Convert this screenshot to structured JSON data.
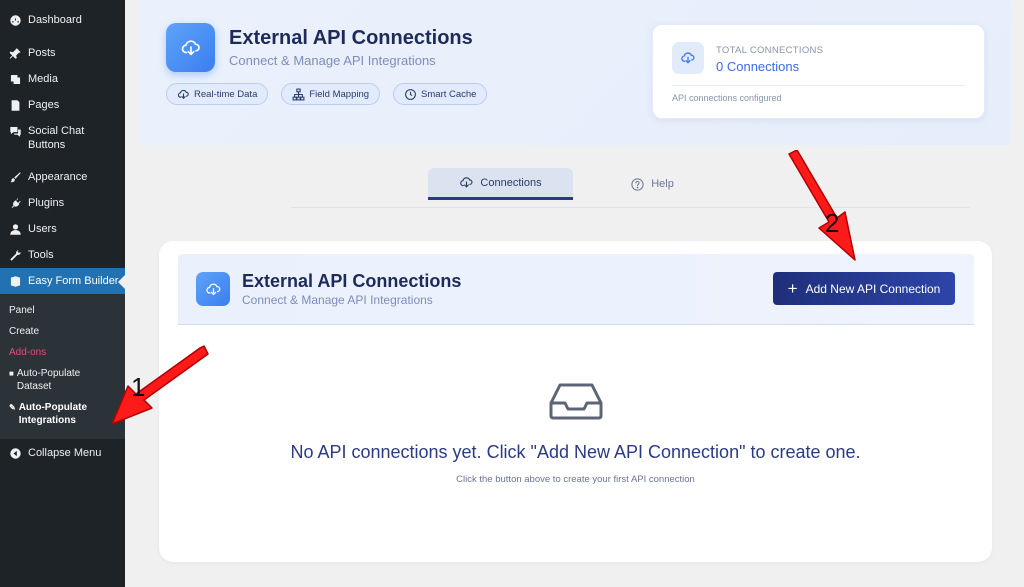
{
  "sidebar": {
    "items": [
      {
        "label": "Dashboard",
        "icon": "dashboard-icon"
      },
      {
        "label": "Posts",
        "icon": "pin-icon"
      },
      {
        "label": "Media",
        "icon": "media-icon"
      },
      {
        "label": "Pages",
        "icon": "pages-icon"
      },
      {
        "label": "Social Chat Buttons",
        "icon": "chat-icon"
      },
      {
        "label": "Appearance",
        "icon": "brush-icon"
      },
      {
        "label": "Plugins",
        "icon": "plug-icon"
      },
      {
        "label": "Users",
        "icon": "user-icon"
      },
      {
        "label": "Tools",
        "icon": "wrench-icon"
      },
      {
        "label": "Easy Form Builder",
        "icon": "form-icon"
      }
    ],
    "submenu": [
      "Panel",
      "Create",
      "Add-ons",
      "Auto-Populate Dataset",
      "Auto-Populate Integrations"
    ],
    "collapse": "Collapse Menu"
  },
  "header": {
    "title": "External API Connections",
    "subtitle": "Connect & Manage API Integrations",
    "chips": [
      "Real-time Data",
      "Field Mapping",
      "Smart Cache"
    ],
    "stat": {
      "label": "TOTAL CONNECTIONS",
      "value": "0 Connections",
      "footer": "API connections configured"
    }
  },
  "tabs": [
    "Connections",
    "Help"
  ],
  "main": {
    "title": "External API Connections",
    "subtitle": "Connect & Manage API Integrations",
    "add_button": "Add New API Connection",
    "empty_title": "No API connections yet. Click \"Add New API Connection\" to create one.",
    "empty_sub": "Click the button above to create your first API connection"
  },
  "annotations": [
    "1",
    "2"
  ],
  "colors": {
    "accent": "#2271b1",
    "primary_button": "#243a8e",
    "annotation_arrow": "#ff1a1a"
  }
}
